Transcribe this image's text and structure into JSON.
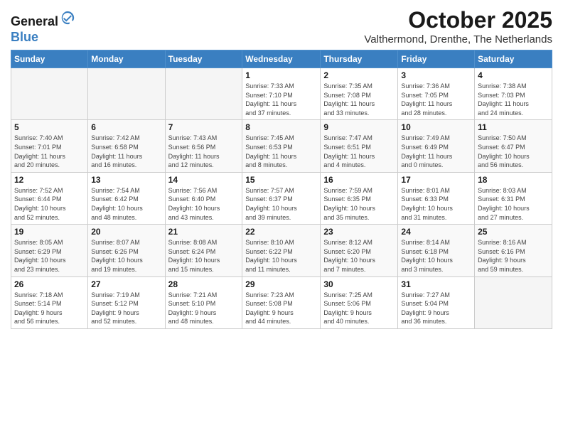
{
  "header": {
    "logo_line1": "General",
    "logo_line2": "Blue",
    "month": "October 2025",
    "location": "Valthermond, Drenthe, The Netherlands"
  },
  "weekdays": [
    "Sunday",
    "Monday",
    "Tuesday",
    "Wednesday",
    "Thursday",
    "Friday",
    "Saturday"
  ],
  "rows": [
    [
      {
        "day": "",
        "info": ""
      },
      {
        "day": "",
        "info": ""
      },
      {
        "day": "",
        "info": ""
      },
      {
        "day": "1",
        "info": "Sunrise: 7:33 AM\nSunset: 7:10 PM\nDaylight: 11 hours\nand 37 minutes."
      },
      {
        "day": "2",
        "info": "Sunrise: 7:35 AM\nSunset: 7:08 PM\nDaylight: 11 hours\nand 33 minutes."
      },
      {
        "day": "3",
        "info": "Sunrise: 7:36 AM\nSunset: 7:05 PM\nDaylight: 11 hours\nand 28 minutes."
      },
      {
        "day": "4",
        "info": "Sunrise: 7:38 AM\nSunset: 7:03 PM\nDaylight: 11 hours\nand 24 minutes."
      }
    ],
    [
      {
        "day": "5",
        "info": "Sunrise: 7:40 AM\nSunset: 7:01 PM\nDaylight: 11 hours\nand 20 minutes."
      },
      {
        "day": "6",
        "info": "Sunrise: 7:42 AM\nSunset: 6:58 PM\nDaylight: 11 hours\nand 16 minutes."
      },
      {
        "day": "7",
        "info": "Sunrise: 7:43 AM\nSunset: 6:56 PM\nDaylight: 11 hours\nand 12 minutes."
      },
      {
        "day": "8",
        "info": "Sunrise: 7:45 AM\nSunset: 6:53 PM\nDaylight: 11 hours\nand 8 minutes."
      },
      {
        "day": "9",
        "info": "Sunrise: 7:47 AM\nSunset: 6:51 PM\nDaylight: 11 hours\nand 4 minutes."
      },
      {
        "day": "10",
        "info": "Sunrise: 7:49 AM\nSunset: 6:49 PM\nDaylight: 11 hours\nand 0 minutes."
      },
      {
        "day": "11",
        "info": "Sunrise: 7:50 AM\nSunset: 6:47 PM\nDaylight: 10 hours\nand 56 minutes."
      }
    ],
    [
      {
        "day": "12",
        "info": "Sunrise: 7:52 AM\nSunset: 6:44 PM\nDaylight: 10 hours\nand 52 minutes."
      },
      {
        "day": "13",
        "info": "Sunrise: 7:54 AM\nSunset: 6:42 PM\nDaylight: 10 hours\nand 48 minutes."
      },
      {
        "day": "14",
        "info": "Sunrise: 7:56 AM\nSunset: 6:40 PM\nDaylight: 10 hours\nand 43 minutes."
      },
      {
        "day": "15",
        "info": "Sunrise: 7:57 AM\nSunset: 6:37 PM\nDaylight: 10 hours\nand 39 minutes."
      },
      {
        "day": "16",
        "info": "Sunrise: 7:59 AM\nSunset: 6:35 PM\nDaylight: 10 hours\nand 35 minutes."
      },
      {
        "day": "17",
        "info": "Sunrise: 8:01 AM\nSunset: 6:33 PM\nDaylight: 10 hours\nand 31 minutes."
      },
      {
        "day": "18",
        "info": "Sunrise: 8:03 AM\nSunset: 6:31 PM\nDaylight: 10 hours\nand 27 minutes."
      }
    ],
    [
      {
        "day": "19",
        "info": "Sunrise: 8:05 AM\nSunset: 6:29 PM\nDaylight: 10 hours\nand 23 minutes."
      },
      {
        "day": "20",
        "info": "Sunrise: 8:07 AM\nSunset: 6:26 PM\nDaylight: 10 hours\nand 19 minutes."
      },
      {
        "day": "21",
        "info": "Sunrise: 8:08 AM\nSunset: 6:24 PM\nDaylight: 10 hours\nand 15 minutes."
      },
      {
        "day": "22",
        "info": "Sunrise: 8:10 AM\nSunset: 6:22 PM\nDaylight: 10 hours\nand 11 minutes."
      },
      {
        "day": "23",
        "info": "Sunrise: 8:12 AM\nSunset: 6:20 PM\nDaylight: 10 hours\nand 7 minutes."
      },
      {
        "day": "24",
        "info": "Sunrise: 8:14 AM\nSunset: 6:18 PM\nDaylight: 10 hours\nand 3 minutes."
      },
      {
        "day": "25",
        "info": "Sunrise: 8:16 AM\nSunset: 6:16 PM\nDaylight: 9 hours\nand 59 minutes."
      }
    ],
    [
      {
        "day": "26",
        "info": "Sunrise: 7:18 AM\nSunset: 5:14 PM\nDaylight: 9 hours\nand 56 minutes."
      },
      {
        "day": "27",
        "info": "Sunrise: 7:19 AM\nSunset: 5:12 PM\nDaylight: 9 hours\nand 52 minutes."
      },
      {
        "day": "28",
        "info": "Sunrise: 7:21 AM\nSunset: 5:10 PM\nDaylight: 9 hours\nand 48 minutes."
      },
      {
        "day": "29",
        "info": "Sunrise: 7:23 AM\nSunset: 5:08 PM\nDaylight: 9 hours\nand 44 minutes."
      },
      {
        "day": "30",
        "info": "Sunrise: 7:25 AM\nSunset: 5:06 PM\nDaylight: 9 hours\nand 40 minutes."
      },
      {
        "day": "31",
        "info": "Sunrise: 7:27 AM\nSunset: 5:04 PM\nDaylight: 9 hours\nand 36 minutes."
      },
      {
        "day": "",
        "info": ""
      }
    ]
  ]
}
